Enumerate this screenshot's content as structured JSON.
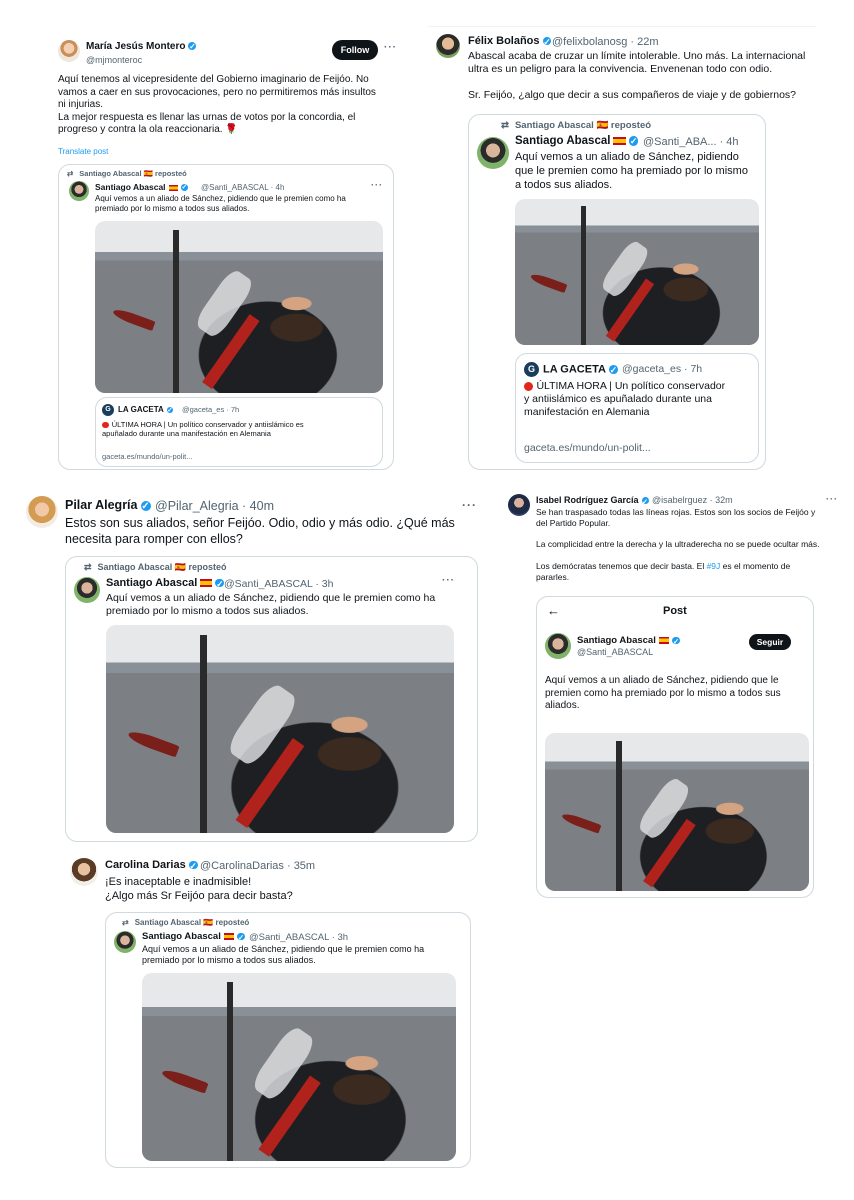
{
  "tweet_montero": {
    "name": "María Jesús Montero",
    "handle": "@mjmonteroc",
    "follow": "Follow",
    "more": "···",
    "text_1": "Aquí tenemos al vicepresidente del Gobierno imaginario de Feijóo. No",
    "text_2": "vamos a caer en sus provocaciones, pero no permitiremos más insultos",
    "text_3": "ni injurias.",
    "text_4": "La mejor respuesta es llenar las urnas de votos por la concordia, el",
    "text_5": "progreso y contra la ola reaccionaria. 🌹",
    "translate": "Translate post",
    "repost_label": "Santiago Abascal 🇪🇸 reposteó",
    "quoted": {
      "name": "Santiago Abascal",
      "handle": "@Santi_ABASCAL · 4h",
      "text_1": "Aquí vemos a un aliado de Sánchez,  pidiendo que le premien como ha",
      "text_2": "premiado por lo mismo a todos sus aliados."
    },
    "link": {
      "source": "LA GACETA",
      "handle": "@gaceta_es · 7h",
      "text_1": "ÚLTIMA HORA | Un político conservador y antiislámico es",
      "text_2": "apuñalado durante una manifestación en Alemania",
      "url": "gaceta.es/mundo/un-polit..."
    }
  },
  "tweet_bolanos": {
    "name": "Félix Bolaños",
    "handle": "@felixbolanosg · 22m",
    "text_1": "Abascal acaba de cruzar un límite intolerable. Uno más. La internacional",
    "text_2": "ultra es un peligro para la convivencia. Envenenan todo con odio.",
    "text_3": "Sr. Feijóo, ¿algo que decir a sus compañeros de viaje y de gobiernos?",
    "repost_label": "Santiago Abascal 🇪🇸 reposteó",
    "quoted": {
      "name": "Santiago Abascal",
      "handle": "@Santi_ABA... · 4h",
      "text_1": "Aquí vemos a un aliado de Sánchez,  pidiendo",
      "text_2": "que le premien como ha premiado por lo mismo",
      "text_3": "a todos sus aliados."
    },
    "link": {
      "source": "LA GACETA",
      "handle": "@gaceta_es · 7h",
      "text_1": "ÚLTIMA HORA | Un político conservador",
      "text_2": "y antiislámico es apuñalado durante una",
      "text_3": "manifestación en Alemania",
      "url": "gaceta.es/mundo/un-polit..."
    }
  },
  "tweet_alegria": {
    "name": "Pilar Alegría",
    "handle": "@Pilar_Alegria · 40m",
    "more": "···",
    "text_1": "Estos son sus aliados, señor Feijóo. Odio, odio y más odio. ¿Qué más",
    "text_2": "necesita para romper con ellos?",
    "repost_label": "Santiago Abascal 🇪🇸 reposteó",
    "quoted": {
      "name": "Santiago Abascal",
      "handle": "@Santi_ABASCAL · 3h",
      "text_1": "Aquí vemos a un aliado de Sánchez,  pidiendo que le premien como ha",
      "text_2": "premiado por lo mismo a todos sus aliados."
    }
  },
  "tweet_darias": {
    "name": "Carolina Darias",
    "handle": "@CarolinaDarias · 35m",
    "text_1": "¡Es inaceptable e inadmisible!",
    "text_2": "¿Algo más Sr Feijóo para decir basta?",
    "repost_label": "Santiago Abascal 🇪🇸 reposteó",
    "quoted": {
      "name": "Santiago Abascal",
      "handle": "@Santi_ABASCAL · 3h",
      "text_1": "Aquí vemos a un aliado de Sánchez,  pidiendo que le premien como ha",
      "text_2": "premiado por lo mismo a todos sus aliados."
    }
  },
  "tweet_rodriguez": {
    "name": "Isabel Rodríguez García",
    "handle": "@isabelrguez · 32m",
    "more": "···",
    "text_1": "Se han traspasado todas las líneas rojas. Estos son los socios de Feijóo y",
    "text_2": "del Partido Popular.",
    "text_3": "La complicidad entre la derecha y la ultraderecha no se puede ocultar más.",
    "text_4a": "Los demócratas tenemos que decir basta. El ",
    "hashtag": "#9J",
    "text_4b": " es el momento de",
    "text_5": "pararles.",
    "embedded": {
      "title": "Post",
      "back": "←",
      "name": "Santiago Abascal",
      "handle": "@Santi_ABASCAL",
      "follow": "Seguir",
      "text_1": "Aquí vemos a un aliado de Sánchez,  pidiendo que le",
      "text_2": "premien como ha premiado por lo mismo a todos sus",
      "text_3": "aliados."
    }
  }
}
